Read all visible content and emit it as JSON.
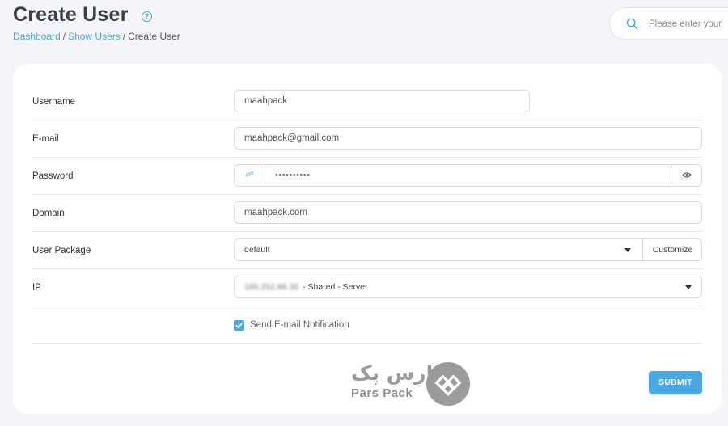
{
  "header": {
    "title": "Create User",
    "breadcrumb": [
      {
        "label": "Dashboard"
      },
      {
        "label": "Show Users"
      },
      {
        "label": "Create User"
      }
    ]
  },
  "search": {
    "placeholder": "Please enter your"
  },
  "form": {
    "username": {
      "label": "Username",
      "value": "maahpack"
    },
    "email": {
      "label": "E-mail",
      "value": "maahpack@gmail.com"
    },
    "password": {
      "label": "Password",
      "value": "••••••••••"
    },
    "domain": {
      "label": "Domain",
      "value": "maahpack.com"
    },
    "package": {
      "label": "User Package",
      "value": "default",
      "customize_label": "Customize"
    },
    "ip": {
      "label": "IP",
      "address": "185.252.86.35",
      "suffix": "- Shared - Server"
    },
    "notify": {
      "label": "Send E-mail Notification",
      "checked": true
    },
    "submit_label": "SUBMIT"
  },
  "logo": {
    "text_fa": "پارس پک",
    "text_en": "Pars Pack"
  },
  "icons": {
    "help": "question-circle-icon",
    "search": "search-icon",
    "link": "link-icon",
    "eye": "eye-icon",
    "caret": "chevron-down-icon",
    "check": "check-icon"
  },
  "colors": {
    "accent": "#4aa8e3",
    "background": "#f3f5f8",
    "card": "#ffffff",
    "title": "#3a3f4a"
  }
}
